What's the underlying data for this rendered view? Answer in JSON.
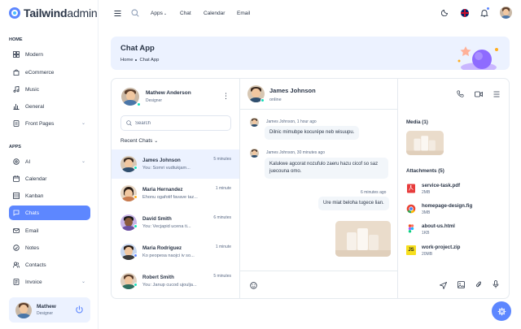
{
  "brand": {
    "name_bold": "Tailwind",
    "name_light": "admin"
  },
  "sidebar": {
    "home_label": "HOME",
    "apps_label": "APPS",
    "home_items": [
      {
        "label": "Modern",
        "icon": "grid-icon"
      },
      {
        "label": "eCommerce",
        "icon": "bag-icon"
      },
      {
        "label": "Music",
        "icon": "music-icon"
      },
      {
        "label": "General",
        "icon": "chart-icon"
      },
      {
        "label": "Front Pages",
        "icon": "page-icon"
      }
    ],
    "app_items": [
      {
        "label": "AI",
        "icon": "ai-icon"
      },
      {
        "label": "Calendar",
        "icon": "calendar-icon"
      },
      {
        "label": "Kanban",
        "icon": "kanban-icon"
      },
      {
        "label": "Chats",
        "icon": "chat-icon"
      },
      {
        "label": "Email",
        "icon": "mail-icon"
      },
      {
        "label": "Notes",
        "icon": "notes-icon"
      },
      {
        "label": "Contacts",
        "icon": "contacts-icon"
      },
      {
        "label": "Invoice",
        "icon": "invoice-icon"
      }
    ],
    "user": {
      "name": "Mathew",
      "role": "Designer"
    }
  },
  "topbar": {
    "links": [
      "Apps",
      "Chat",
      "Calendar",
      "Email"
    ]
  },
  "banner": {
    "title": "Chat App",
    "crumb_home": "Home",
    "crumb_current": "Chat App"
  },
  "chat_list": {
    "me": {
      "name": "Mathew Anderson",
      "role": "Designer"
    },
    "search_placeholder": "Search",
    "recent_label": "Recent Chats",
    "contacts": [
      {
        "name": "James Johnson",
        "message": "You: Somri vudtukjam...",
        "time": "5 minutes",
        "status_color": "#13deb9"
      },
      {
        "name": "Maria Hernandez",
        "message": "Ehonu ogafotif favave taz...",
        "time": "1 minute",
        "status_color": "#ffae1f"
      },
      {
        "name": "David Smith",
        "message": "You: Vecjapid ucena ti...",
        "time": "6 minutes",
        "status_color": "#13deb9"
      },
      {
        "name": "Maria Rodriguez",
        "message": "Ko peopesa naojci iv so...",
        "time": "1 minute",
        "status_color": "#5d87ff"
      },
      {
        "name": "Robert Smith",
        "message": "You: Janup cucod ujoulja...",
        "time": "5 minutes",
        "status_color": "#13deb9"
      }
    ]
  },
  "conversation": {
    "name": "James Johnson",
    "status": "online",
    "messages": [
      {
        "meta": "James Johnson, 1 hour ago",
        "text": "Dilnic mimubpe kocurépe neb wisuupu."
      },
      {
        "meta": "James Johnson, 30 minutes ago",
        "text_line1": "Kalukwe agcorat nozufulo zaeru hazu cicof so saz",
        "text_line2": "juecouna omo."
      },
      {
        "meta": "6 minutes ago",
        "text": "Ure miat beloha tugece lian."
      }
    ]
  },
  "media": {
    "media_title": "Media (1)",
    "attachments_title": "Attachments (5)",
    "files": [
      {
        "name": "service-task.pdf",
        "size": "2MB",
        "icon": "pdf-icon"
      },
      {
        "name": "homepage-design.fig",
        "size": "3MB",
        "icon": "chrome-icon"
      },
      {
        "name": "about-us.html",
        "size": "1KB",
        "icon": "figma-icon"
      },
      {
        "name": "work-project.zip",
        "size": "20MB",
        "icon": "js-icon"
      }
    ]
  }
}
